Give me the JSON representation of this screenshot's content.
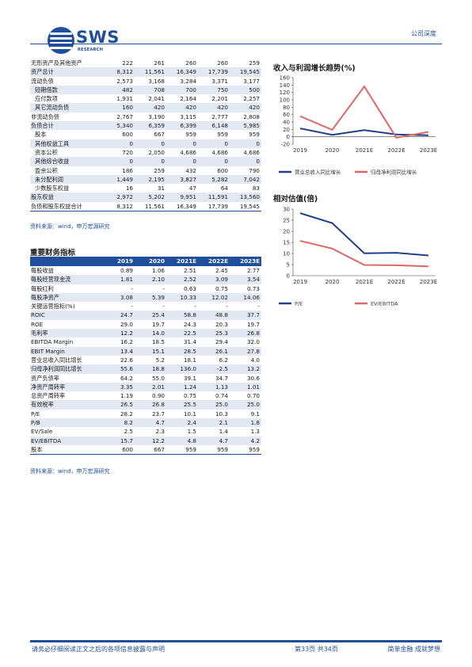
{
  "header": {
    "logo_text": "SWS",
    "logo_sub": "RESEARCH",
    "doc_type": "公司深度"
  },
  "balance_sheet": {
    "rows": [
      {
        "label": "无形资产及其他资产",
        "indent": false,
        "values": [
          "222",
          "261",
          "260",
          "260",
          "259"
        ]
      },
      {
        "label": "资产总计",
        "indent": false,
        "values": [
          "8,312",
          "11,561",
          "16,349",
          "17,739",
          "19,545"
        ]
      },
      {
        "label": "流动负债",
        "indent": false,
        "values": [
          "2,573",
          "3,168",
          "3,284",
          "3,371",
          "3,177"
        ]
      },
      {
        "label": "短期借款",
        "indent": true,
        "values": [
          "482",
          "708",
          "700",
          "750",
          "500"
        ]
      },
      {
        "label": "应付款项",
        "indent": true,
        "values": [
          "1,931",
          "2,041",
          "2,164",
          "2,201",
          "2,257"
        ]
      },
      {
        "label": "其它流动负债",
        "indent": true,
        "values": [
          "160",
          "420",
          "420",
          "420",
          "420"
        ]
      },
      {
        "label": "非流动负债",
        "indent": false,
        "values": [
          "2,767",
          "3,190",
          "3,115",
          "2,777",
          "2,808"
        ]
      },
      {
        "label": "负债合计",
        "indent": false,
        "values": [
          "5,340",
          "6,359",
          "6,399",
          "6,148",
          "5,985"
        ]
      },
      {
        "label": "股本",
        "indent": true,
        "values": [
          "600",
          "667",
          "959",
          "959",
          "959"
        ]
      },
      {
        "label": "其他权益工具",
        "indent": true,
        "values": [
          "0",
          "0",
          "0",
          "0",
          "0"
        ]
      },
      {
        "label": "资本公积",
        "indent": true,
        "values": [
          "720",
          "2,050",
          "4,686",
          "4,686",
          "4,686"
        ]
      },
      {
        "label": "其他综合收益",
        "indent": true,
        "values": [
          "0",
          "0",
          "0",
          "0",
          "0"
        ]
      },
      {
        "label": "盈余公积",
        "indent": true,
        "values": [
          "186",
          "259",
          "432",
          "600",
          "790"
        ]
      },
      {
        "label": "未分配利润",
        "indent": true,
        "values": [
          "1,449",
          "2,195",
          "3,827",
          "5,282",
          "7,042"
        ]
      },
      {
        "label": "少数股东权益",
        "indent": true,
        "values": [
          "16",
          "31",
          "47",
          "64",
          "83"
        ]
      },
      {
        "label": "股东权益",
        "indent": false,
        "values": [
          "2,972",
          "5,202",
          "9,951",
          "11,591",
          "13,560"
        ]
      },
      {
        "label": "负债和股东权益合计",
        "indent": false,
        "values": [
          "8,312",
          "11,561",
          "16,349",
          "17,739",
          "19,545"
        ]
      }
    ],
    "source": "资料来源：wind，申万宏源研究"
  },
  "key_indicators": {
    "title": "重要财务指标",
    "columns": [
      "",
      "2019",
      "2020",
      "2021E",
      "2022E",
      "2023E"
    ],
    "rows": [
      {
        "label": "每股收益",
        "values": [
          "0.89",
          "1.06",
          "2.51",
          "2.45",
          "2.77"
        ]
      },
      {
        "label": "每股经营现金流",
        "values": [
          "1.81",
          "2.10",
          "2.52",
          "3.09",
          "3.54"
        ]
      },
      {
        "label": "每股红利",
        "values": [
          "-",
          "-",
          "0.63",
          "0.75",
          "0.73"
        ]
      },
      {
        "label": "每股净资产",
        "values": [
          "3.08",
          "5.39",
          "10.33",
          "12.02",
          "14.06"
        ]
      },
      {
        "label": "关键运营指标(%)",
        "values": [
          "-",
          "-",
          "-",
          "-",
          "-"
        ]
      },
      {
        "label": "ROIC",
        "values": [
          "24.7",
          "25.4",
          "58.8",
          "48.8",
          "37.7"
        ]
      },
      {
        "label": "ROE",
        "values": [
          "29.0",
          "19.7",
          "24.3",
          "20.3",
          "19.7"
        ]
      },
      {
        "label": "毛利率",
        "values": [
          "12.2",
          "14.0",
          "22.5",
          "25.3",
          "26.8"
        ]
      },
      {
        "label": "EBITDA Margin",
        "values": [
          "16.2",
          "18.5",
          "31.4",
          "29.4",
          "32.0"
        ]
      },
      {
        "label": "EBIT  Margin",
        "values": [
          "13.4",
          "15.1",
          "28.5",
          "26.1",
          "27.8"
        ]
      },
      {
        "label": "营业总收入同比增长",
        "values": [
          "22.6",
          "5.2",
          "18.1",
          "6.2",
          "4.0"
        ]
      },
      {
        "label": "归母净利润同比增长",
        "values": [
          "55.6",
          "18.8",
          "136.0",
          "-2.5",
          "13.2"
        ]
      },
      {
        "label": "资产负债率",
        "values": [
          "64.2",
          "55.0",
          "39.1",
          "34.7",
          "30.6"
        ]
      },
      {
        "label": "净资产周转率",
        "values": [
          "3.35",
          "2.01",
          "1.24",
          "1.13",
          "1.01"
        ]
      },
      {
        "label": "总资产周转率",
        "values": [
          "1.19",
          "0.90",
          "0.75",
          "0.74",
          "0.70"
        ]
      },
      {
        "label": "有效税率",
        "values": [
          "26.5",
          "26.8",
          "25.5",
          "25.0",
          "25.0"
        ]
      },
      {
        "label": "P/E",
        "values": [
          "28.2",
          "23.7",
          "10.1",
          "10.3",
          "9.1"
        ]
      },
      {
        "label": "P/B",
        "values": [
          "8.2",
          "4.7",
          "2.4",
          "2.1",
          "1.8"
        ]
      },
      {
        "label": "EV/Sale",
        "values": [
          "2.5",
          "2.3",
          "1.5",
          "1.4",
          "1.3"
        ]
      },
      {
        "label": "EV/EBITDA",
        "values": [
          "15.7",
          "12.2",
          "4.8",
          "4.7",
          "4.2"
        ]
      },
      {
        "label": "股本",
        "values": [
          "600",
          "667",
          "959",
          "959",
          "959"
        ]
      }
    ],
    "source": "资料来源：wind，申万宏源研究"
  },
  "chart_data": [
    {
      "type": "line",
      "title": "收入与利润增长趋势(%)",
      "categories": [
        "2019",
        "2020",
        "2021E",
        "2022E",
        "2023E"
      ],
      "ylim": [
        -20,
        160
      ],
      "yticks": [
        "-20",
        "0",
        "20",
        "40",
        "60",
        "80",
        "100",
        "120",
        "140",
        "160"
      ],
      "series": [
        {
          "name": "营业总收入同比增长",
          "values": [
            22.6,
            5.2,
            18.1,
            6.2,
            4.0
          ],
          "color": "#1f3f8a"
        },
        {
          "name": "归母净利润同比增长",
          "values": [
            55.6,
            18.8,
            136.0,
            -2.5,
            13.2
          ],
          "color": "#e06666"
        }
      ],
      "legend": "bottom",
      "grid": false
    },
    {
      "type": "line",
      "title": "相对估值(倍)",
      "categories": [
        "2019",
        "2020",
        "2021E",
        "2022E",
        "2023E"
      ],
      "ylim": [
        0,
        30
      ],
      "yticks": [
        "0",
        "5",
        "10",
        "15",
        "20",
        "25",
        "30"
      ],
      "series": [
        {
          "name": "P/E",
          "values": [
            28.2,
            23.7,
            10.1,
            10.3,
            9.1
          ],
          "color": "#1f3f8a"
        },
        {
          "name": "EV/EBITDA",
          "values": [
            15.7,
            12.2,
            4.8,
            4.7,
            4.2
          ],
          "color": "#e06666"
        }
      ],
      "legend": "bottom",
      "grid": false
    }
  ],
  "footer": {
    "disclaimer": "请务必仔细阅读正文之后的各项信息披露与声明",
    "page": "第33页 共34页",
    "slogan": "简单金融 成就梦想"
  }
}
